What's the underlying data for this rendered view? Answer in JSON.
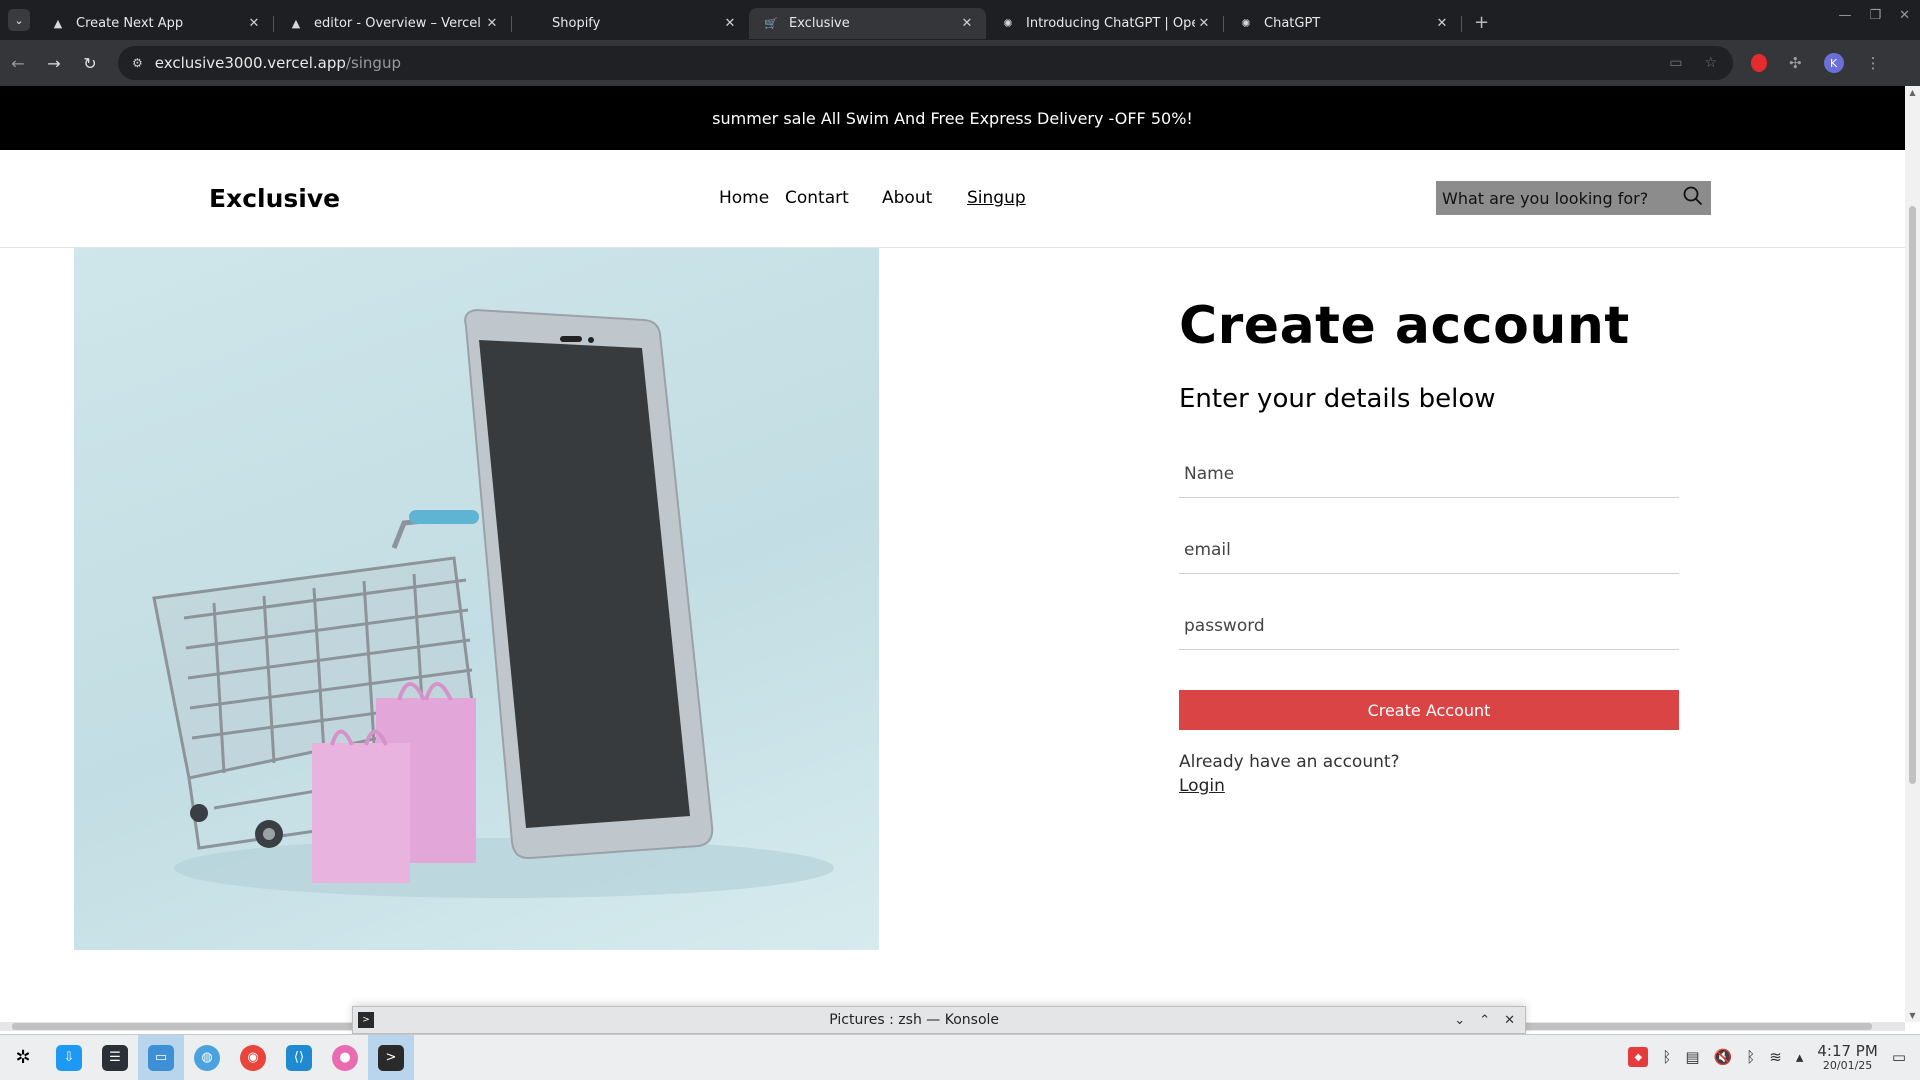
{
  "browser": {
    "tabs": [
      {
        "title": "Create Next App",
        "favicon": "vercel-triangle-icon",
        "active": false
      },
      {
        "title": "editor - Overview – Vercel",
        "favicon": "vercel-triangle-icon",
        "active": false
      },
      {
        "title": "Shopify",
        "favicon": "",
        "active": false
      },
      {
        "title": "Exclusive",
        "favicon": "cart-icon",
        "active": true
      },
      {
        "title": "Introducing ChatGPT | Ope",
        "favicon": "openai-icon",
        "active": false
      },
      {
        "title": "ChatGPT",
        "favicon": "openai-icon",
        "active": false
      }
    ],
    "url_host": "exclusive3000.vercel.app",
    "url_path": "/singup",
    "profile_initial": "K"
  },
  "page": {
    "promo": "summer sale All Swim And Free Express Delivery -OFF 50%!",
    "logo": "Exclusive",
    "nav": [
      "Home",
      "Contart",
      "About",
      "Singup"
    ],
    "search_placeholder": "What are you looking for?",
    "form": {
      "title": "Create account",
      "subtitle": "Enter your details below",
      "name_placeholder": "Name",
      "email_placeholder": "email",
      "password_placeholder": "password",
      "submit": "Create Account",
      "already": "Already have an account?",
      "login": "Login"
    },
    "accent_color": "#db4444"
  },
  "konsole": {
    "title": "Pictures : zsh — Konsole"
  },
  "taskbar": {
    "time": "4:17 PM",
    "date": "20/01/25"
  }
}
